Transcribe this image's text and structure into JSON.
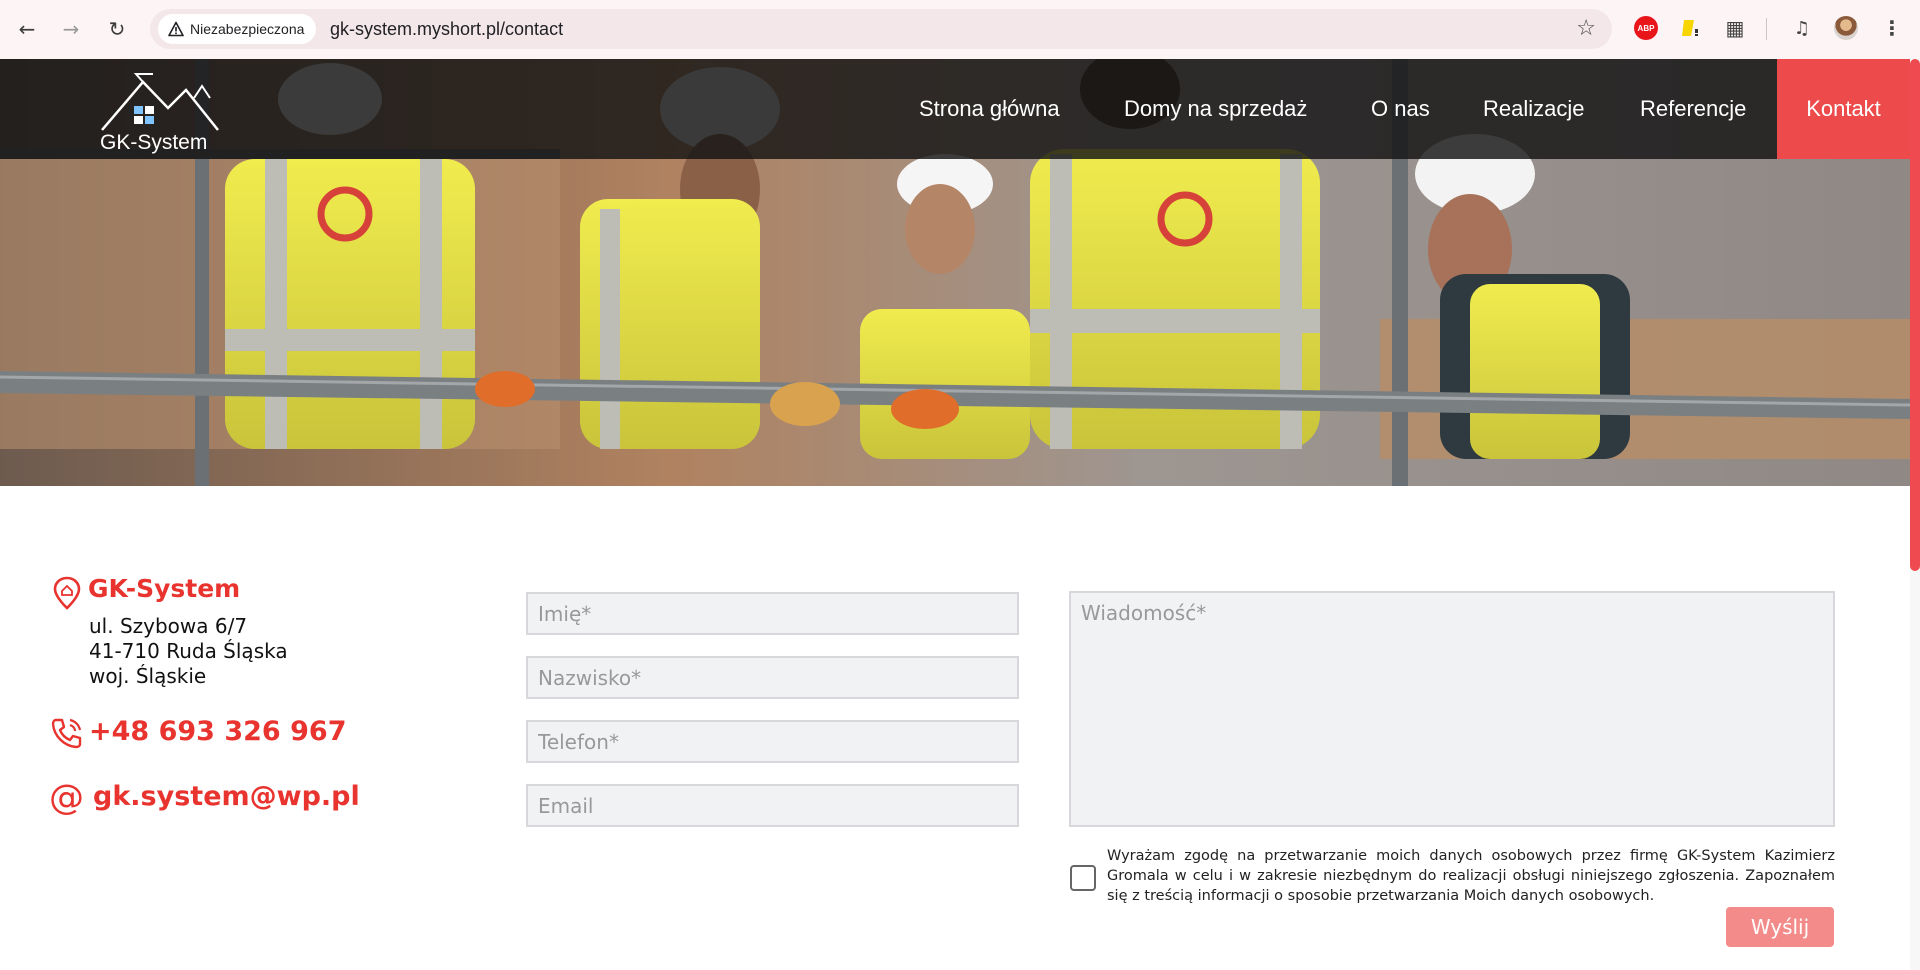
{
  "browser": {
    "security_label": "Niezabezpieczona",
    "url": "gk-system.myshort.pl/contact",
    "abp_label": "ABP",
    "icons": [
      "back-arrow-icon",
      "forward-arrow-icon",
      "reload-icon",
      "warning-icon",
      "star-icon",
      "adblock-icon",
      "extension-icon",
      "puzzle-icon",
      "media-icon",
      "avatar-icon",
      "more-menu-icon"
    ]
  },
  "site": {
    "logo_text": "GK-System",
    "nav": [
      "Strona główna",
      "Domy na sprzedaż",
      "O nas",
      "Realizacje",
      "Referencje",
      "Kontakt"
    ],
    "accent_color": "#ed4b4b"
  },
  "contact": {
    "company": "GK-System",
    "address_line1": "ul. Szybowa 6/7",
    "address_line2": "41-710 Ruda Śląska",
    "address_line3": "woj. Śląskie",
    "phone": "+48 693 326 967",
    "email": "gk.system@wp.pl"
  },
  "form": {
    "first_name_placeholder": "Imię*",
    "last_name_placeholder": "Nazwisko*",
    "phone_placeholder": "Telefon*",
    "email_placeholder": "Email",
    "message_placeholder": "Wiadomość*",
    "consent_text": "Wyrażam zgodę na przetwarzanie moich danych osobowych przez firmę GK-System Kazimierz Gromala w celu i w zakresie niezbędnym do realizacji obsługi niniejszego zgłoszenia. Zapoznałem się z treścią informacji o sposobie przetwarzania Moich danych osobowych.",
    "consent_checked": false,
    "submit_label": "Wyślij"
  }
}
